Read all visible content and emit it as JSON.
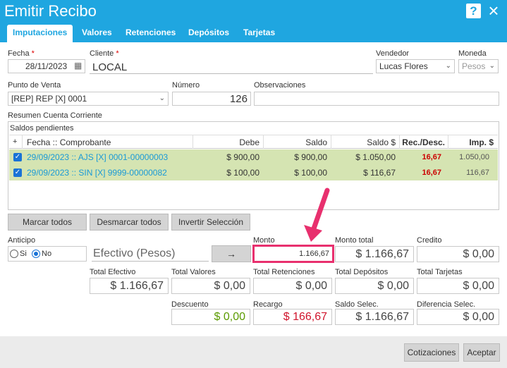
{
  "window": {
    "title": "Emitir Recibo"
  },
  "tabs": [
    "Imputaciones",
    "Valores",
    "Retenciones",
    "Depósitos",
    "Tarjetas"
  ],
  "form": {
    "fecha_label": "Fecha",
    "fecha": "28/11/2023",
    "cliente_label": "Cliente",
    "cliente": "LOCAL",
    "vendedor_label": "Vendedor",
    "vendedor": "Lucas Flores",
    "moneda_label": "Moneda",
    "moneda": "Pesos",
    "punto_label": "Punto de Venta",
    "punto": "[REP] REP [X] 0001",
    "numero_label": "Número",
    "numero": "126",
    "obs_label": "Observaciones",
    "obs": ""
  },
  "resumen": {
    "title": "Resumen Cuenta Corriente",
    "subtitle": "Saldos pendientes",
    "headers": [
      "+",
      "Fecha :: Comprobante",
      "Debe",
      "Saldo",
      "Saldo $",
      "Rec./Desc.",
      "Imp. $"
    ],
    "rows": [
      {
        "comprobante": "29/09/2023 :: AJS [X] 0001-00000003",
        "debe": "$ 900,00",
        "saldo": "$ 900,00",
        "saldo_ps": "$ 1.050,00",
        "rec": "16,67",
        "imp": "1.050,00"
      },
      {
        "comprobante": "29/09/2023 :: SIN [X] 9999-00000082",
        "debe": "$ 100,00",
        "saldo": "$ 100,00",
        "saldo_ps": "$ 116,67",
        "rec": "16,67",
        "imp": "116,67"
      }
    ]
  },
  "buttons": {
    "marcar": "Marcar todos",
    "desmarcar": "Desmarcar todos",
    "invertir": "Invertir Selección",
    "arrow": "→",
    "cotizaciones": "Cotizaciones",
    "aceptar": "Aceptar"
  },
  "anticipo": {
    "label": "Anticipo",
    "si": "Si",
    "no": "No",
    "selected": "No"
  },
  "medio": "Efectivo (Pesos)",
  "totals": {
    "monto_label": "Monto",
    "monto": "1.166,67",
    "monto_total_label": "Monto total",
    "monto_total": "$ 1.166,67",
    "credito_label": "Credito",
    "credito": "$ 0,00",
    "total_efectivo_label": "Total Efectivo",
    "total_efectivo": "$ 1.166,67",
    "total_valores_label": "Total Valores",
    "total_valores": "$ 0,00",
    "total_retenciones_label": "Total Retenciones",
    "total_retenciones": "$ 0,00",
    "total_depositos_label": "Total Depósitos",
    "total_depositos": "$ 0,00",
    "total_tarjetas_label": "Total Tarjetas",
    "total_tarjetas": "$ 0,00",
    "descuento_label": "Descuento",
    "descuento": "$ 0,00",
    "recargo_label": "Recargo",
    "recargo": "$ 166,67",
    "saldo_selec_label": "Saldo Selec.",
    "saldo_selec": "$ 1.166,67",
    "diferencia_label": "Diferencia Selec.",
    "diferencia": "$ 0,00"
  },
  "colors": {
    "accent": "#1fa6e0",
    "highlight": "#e8306e",
    "descuento": "#5a9a00",
    "recargo": "#d0142c"
  }
}
